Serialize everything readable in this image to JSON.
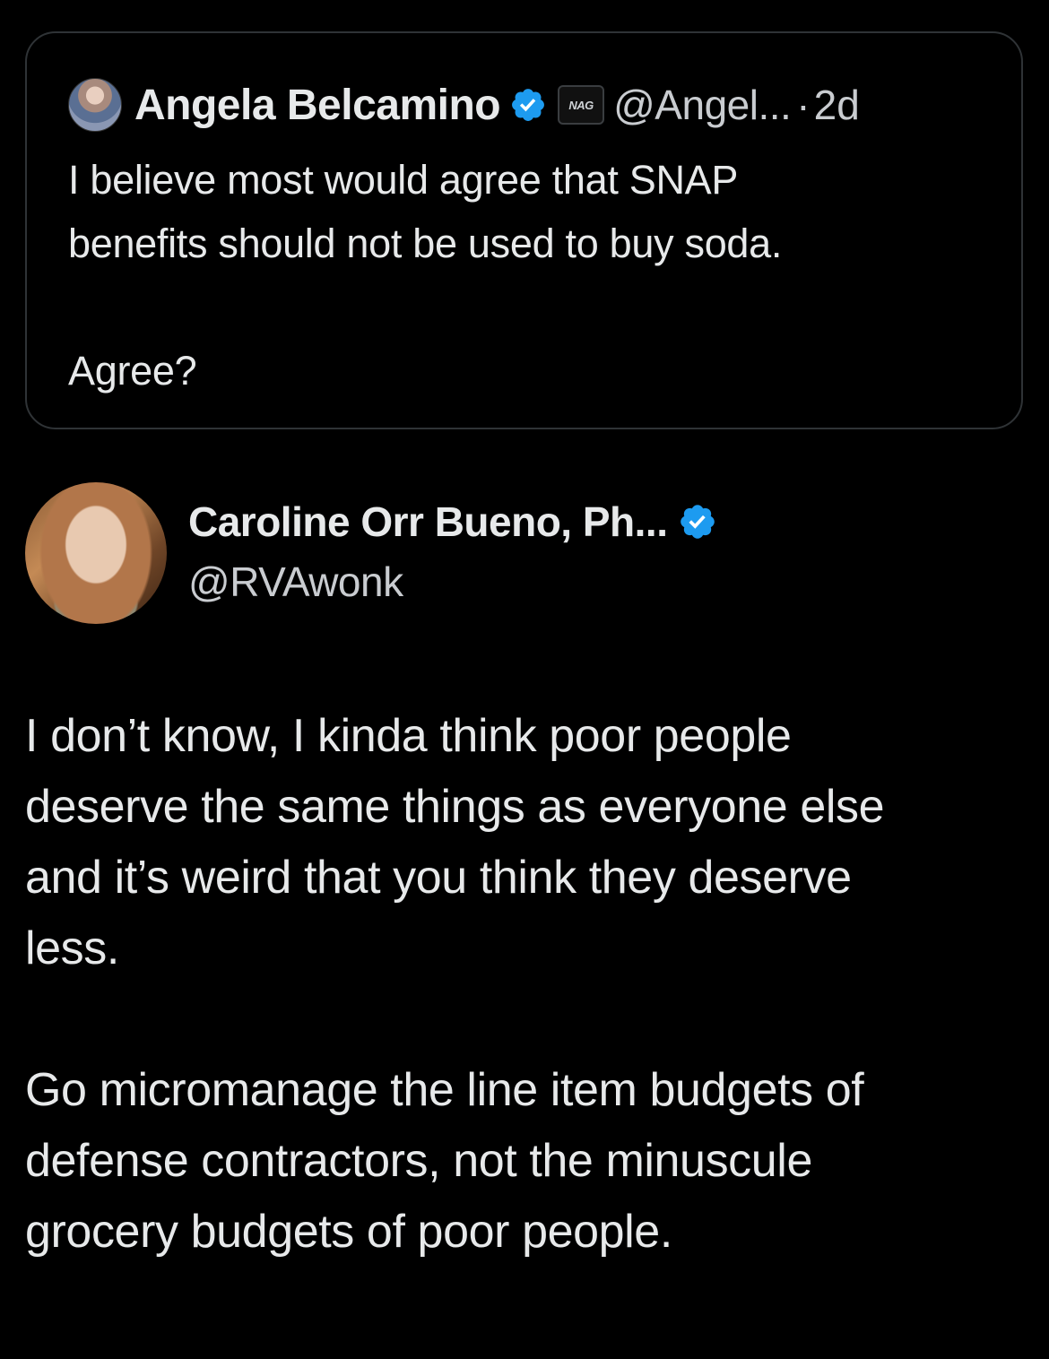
{
  "quoted_tweet": {
    "author_name": "Angela Belcamino",
    "affiliate_badge": "NAG",
    "handle": "@Angel...",
    "separator": "·",
    "time": "2d",
    "text": "I believe most would agree that SNAP\nbenefits should not be used to buy soda.\n\nAgree?"
  },
  "tweet": {
    "author_name": "Caroline Orr Bueno, Ph...",
    "handle": "@RVAwonk",
    "text": "I don’t know, I kinda think poor people\ndeserve the same things as everyone else\nand it’s weird that you think they deserve\nless.\n\nGo micromanage the line item budgets of\ndefense contractors, not the minuscule\ngrocery budgets of poor people."
  },
  "colors": {
    "background": "#000000",
    "text": "#e7e9ea",
    "secondary_text": "#c9ccd0",
    "verified_blue": "#1d9bf0",
    "card_border": "#2f3336"
  },
  "icons": {
    "verified": "verified-badge-icon",
    "affiliate": "affiliate-badge-icon"
  }
}
